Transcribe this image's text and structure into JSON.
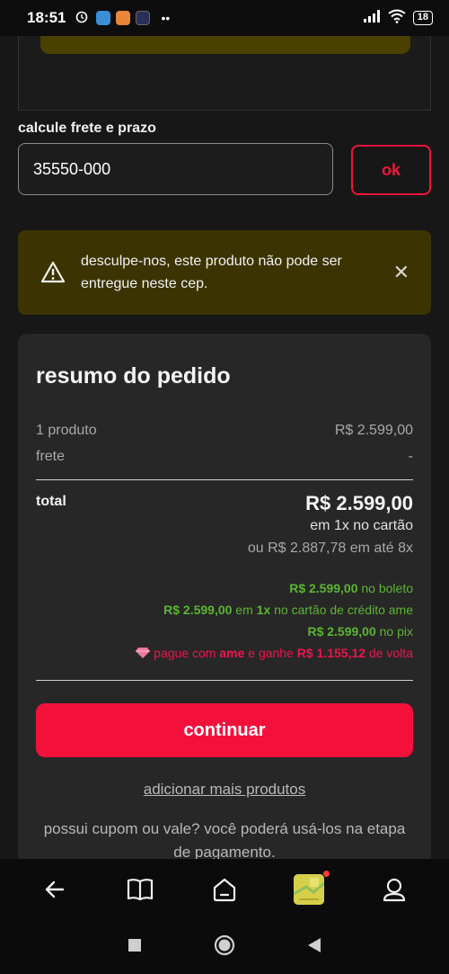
{
  "status_bar": {
    "time": "18:51",
    "battery": "18"
  },
  "shipping": {
    "label": "calcule frete e prazo",
    "cep_value": "35550-000",
    "ok_label": "ok"
  },
  "alert": {
    "message": "desculpe-nos, este produto não pode ser entregue neste cep.",
    "close_glyph": "✕"
  },
  "summary": {
    "title": "resumo do pedido",
    "products_label": "1 produto",
    "products_value": "R$ 2.599,00",
    "shipping_label": "frete",
    "shipping_value": "-",
    "total_label": "total",
    "total_value": "R$ 2.599,00",
    "installment_1": "em 1x no cartão",
    "installment_8": "ou R$ 2.887,78 em até 8x",
    "boleto": {
      "amount": "R$ 2.599,00",
      "suffix": " no boleto"
    },
    "ame_card": {
      "amount": "R$ 2.599,00",
      "mid": " em ",
      "times": "1x",
      "suffix": " no cartão de crédito ame"
    },
    "pix": {
      "amount": "R$ 2.599,00",
      "suffix": " no pix"
    },
    "ame_cashback": {
      "prefix": "pague com ",
      "brand": "ame",
      "mid": " e ganhe ",
      "amount": "R$ 1.155,12",
      "suffix": " de volta"
    },
    "continue_label": "continuar",
    "add_more_label": "adicionar mais produtos",
    "coupon_text": "possui cupom ou vale? você poderá usá-los na etapa de pagamento."
  },
  "colors": {
    "accent": "#f5103c",
    "green": "#5cb531",
    "alert_bg": "#3b3400"
  }
}
